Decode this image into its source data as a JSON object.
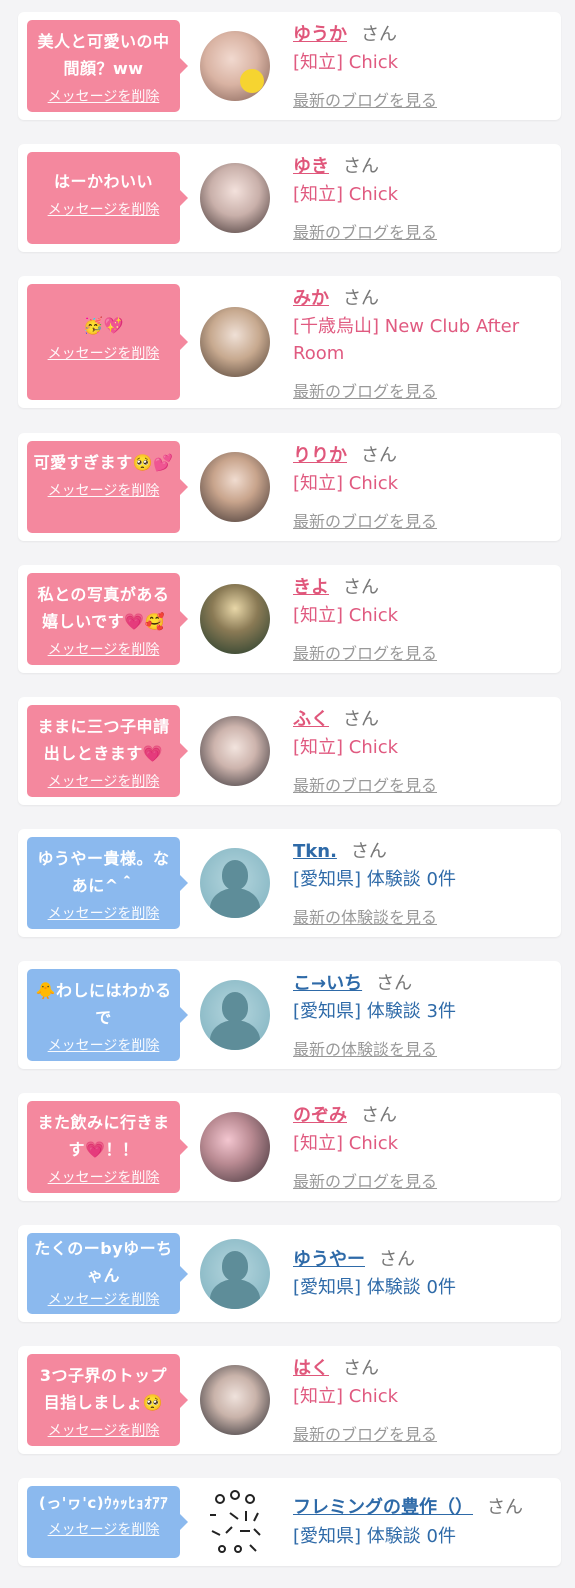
{
  "delete_label": "メッセージを削除",
  "san_label": "さん",
  "colors": {
    "pink_bubble": "#f4889e",
    "blue_bubble": "#8bb9ee",
    "pink_name": "#e0577b",
    "blue_name": "#2e6aa8"
  },
  "items": [
    {
      "message": "美人と可愛いの中間顔？ww",
      "name": "ゆうか",
      "shop": "[知立] Chick",
      "link": "最新のブログを見る",
      "theme": "pink",
      "avatar_icon": "user-photo"
    },
    {
      "message": "はーかわいい",
      "name": "ゆき",
      "shop": "[知立] Chick",
      "link": "最新のブログを見る",
      "theme": "pink",
      "avatar_icon": "user-photo"
    },
    {
      "message": "🥳💖",
      "name": "みか",
      "shop": "[千歳烏山] New Club After Room",
      "link": "最新のブログを見る",
      "theme": "pink",
      "avatar_icon": "user-photo"
    },
    {
      "message": "可愛すぎます🥺💕",
      "name": "りりか",
      "shop": "[知立] Chick",
      "link": "最新のブログを見る",
      "theme": "pink",
      "avatar_icon": "user-photo"
    },
    {
      "message": "私との写真がある嬉しいです💗🥰",
      "name": "きよ",
      "shop": "[知立] Chick",
      "link": "最新のブログを見る",
      "theme": "pink",
      "avatar_icon": "user-photo"
    },
    {
      "message": "ままに三つ子申請出しときます💗",
      "name": "ふく",
      "shop": "[知立] Chick",
      "link": "最新のブログを見る",
      "theme": "pink",
      "avatar_icon": "user-photo"
    },
    {
      "message": "ゆうやー貴様。なあに^＾",
      "name": "Tkn.",
      "shop": "[愛知県] 体験談 0件",
      "link": "最新の体験談を見る",
      "theme": "blue",
      "avatar_icon": "no-photo"
    },
    {
      "message": "🐥わしにはわかるで",
      "name": "こ→いち",
      "shop": "[愛知県] 体験談 3件",
      "link": "最新の体験談を見る",
      "theme": "blue",
      "avatar_icon": "no-photo"
    },
    {
      "message": "また飲みに行きます💗！！",
      "name": "のぞみ",
      "shop": "[知立] Chick",
      "link": "最新のブログを見る",
      "theme": "pink",
      "avatar_icon": "user-photo"
    },
    {
      "message": "たくのーbyゆーちゃん",
      "name": "ゆうやー",
      "shop": "[愛知県] 体験談 0件",
      "link": "",
      "theme": "blue",
      "avatar_icon": "no-photo"
    },
    {
      "message": "3つ子界のトップ目指しましょ🥺",
      "name": "はく",
      "shop": "[知立] Chick",
      "link": "最新のブログを見る",
      "theme": "pink",
      "avatar_icon": "user-photo"
    },
    {
      "message": "(っ'ヮ'c)ｳｩｯﾋｮｵｱｱ",
      "name": "フレミングの豊作（）",
      "shop": "[愛知県] 体験談 0件",
      "link": "",
      "theme": "blue",
      "avatar_icon": "doodle-photo"
    }
  ]
}
